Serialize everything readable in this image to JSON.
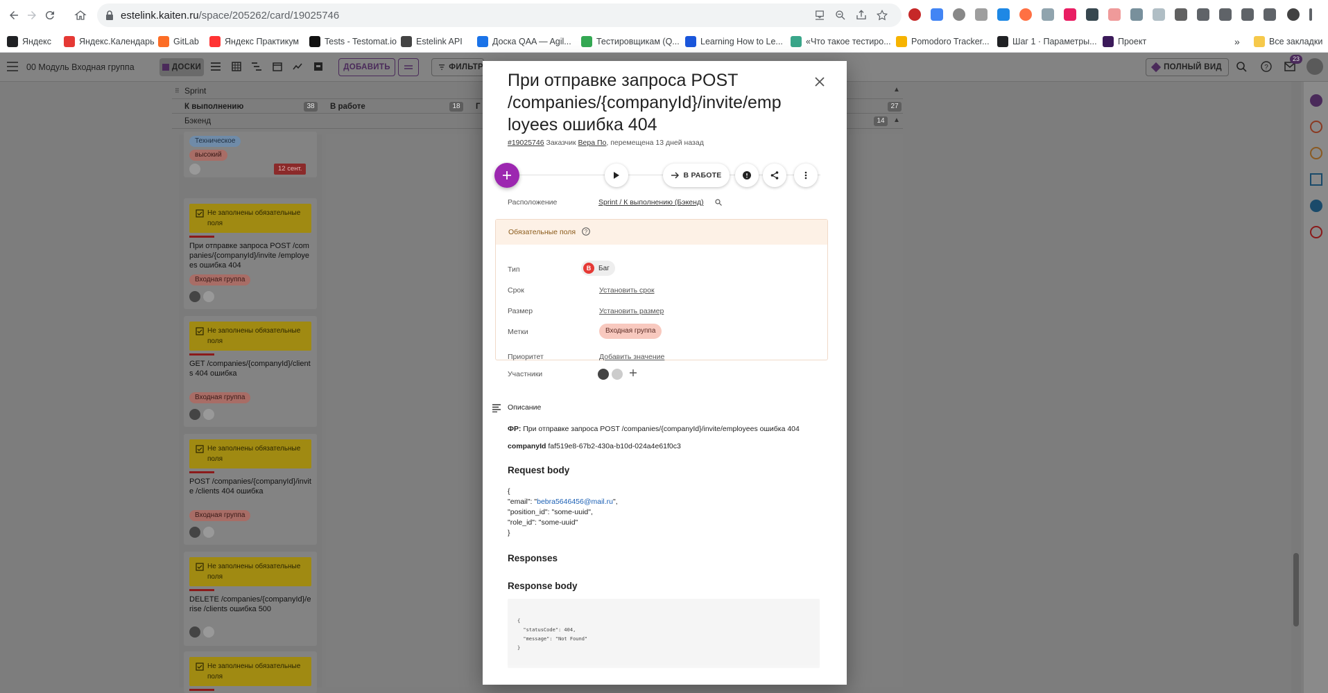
{
  "browser": {
    "url_host": "estelink.kaiten.ru",
    "url_path": "/space/205262/card/19025746",
    "bookmarks": [
      {
        "label": "Яндекс",
        "color": "#202124"
      },
      {
        "label": "Яндекс.Календарь",
        "color": "#e53935"
      },
      {
        "label": "GitLab",
        "color": "#fc6d26"
      },
      {
        "label": "Яндекс Практикум",
        "color": "#ff3333"
      },
      {
        "label": "Tests - Testomat.io",
        "color": "#111111"
      },
      {
        "label": "Estelink API",
        "color": "#444444"
      },
      {
        "label": "Доска QAA — Agil...",
        "color": "#1a73e8"
      },
      {
        "label": "Тестировщикам (Q...",
        "color": "#34a853"
      },
      {
        "label": "Learning How to Le...",
        "color": "#1a56db"
      },
      {
        "label": "«Что такое тестиро...",
        "color": "#3aa68a"
      },
      {
        "label": "Pomodoro Tracker...",
        "color": "#f6b300"
      },
      {
        "label": "Шаг 1 · Параметры...",
        "color": "#202124"
      },
      {
        "label": "Проект",
        "color": "#3b1a5a"
      }
    ],
    "bookmarks_overflow": "»",
    "all_bookmarks": "Все закладки"
  },
  "app": {
    "space_title": "00 Модуль Входная группа",
    "view_boards": "ДОСКИ",
    "add_label": "ДОБАВИТЬ",
    "filter_label": "ФИЛЬТР",
    "full_view_label": "ПОЛНЫЙ ВИД",
    "notif_count": "23",
    "lane_name": "Sprint",
    "columns": [
      {
        "title": "К выполнению",
        "count": "38"
      },
      {
        "title": "В работе",
        "count": "18"
      },
      {
        "title": "Г",
        "count": ""
      },
      {
        "title": "",
        "count": "27"
      }
    ],
    "sublane": "Бэкенд",
    "sublane_count": "14",
    "cards": [
      {
        "tags": [
          "Техническое",
          "высокий"
        ],
        "date": "12 сент."
      },
      {
        "warning": "Не заполнены обязательные поля",
        "title": "При отправке запроса POST /companies/{companyId}/invite /employees ошибка 404",
        "tag": "Входная группа"
      },
      {
        "warning": "Не заполнены обязательные поля",
        "title": "GET /companies/{companyId}/client s 404 ошибка",
        "tag": "Входная группа"
      },
      {
        "warning": "Не заполнены обязательные поля",
        "title": "POST /companies/{companyId}/invite /clients 404 ошибка",
        "tag": "Входная группа"
      },
      {
        "warning": "Не заполнены обязательные поля",
        "title": "DELETE /companies/{companyId}/erise /clients ошибка 500",
        "tag": ""
      },
      {
        "warning": "Не заполнены обязательные поля",
        "title": "",
        "tag": ""
      }
    ]
  },
  "modal": {
    "title": "При отправке запроса POST /companies/{companyId}/invite/emp loyees ошибка 404",
    "card_id": "#19025746",
    "meta_customer_label": "Заказчик",
    "meta_customer": "Вера По",
    "meta_moved": ", перемещена 13 дней назад",
    "in_work_label": "В РАБОТЕ",
    "location_label": "Расположение",
    "location_value": "Sprint / К выполнению (Бэкенд)",
    "required_title": "Обязательные поля",
    "fields": {
      "type_label": "Тип",
      "type_badge": "B",
      "type_value": "Баг",
      "due_label": "Срок",
      "due_value": "Установить срок",
      "size_label": "Размер",
      "size_value": "Установить размер",
      "tags_label": "Метки",
      "tags_value": "Входная группа",
      "priority_label": "Приоритет",
      "priority_value": "Добавить значение"
    },
    "members_label": "Участники",
    "description_label": "Описание",
    "fr_label": "ФР:",
    "fr_text": "При отправке запроса POST /companies/{companyId}/invite/employees ошибка 404",
    "company_label": "companyId",
    "company_value": "faf519e8-67b2-430a-b10d-024a4e61f0c3",
    "request_body_title": "Request body",
    "request_body_line1": "{",
    "request_body_email_key": "\"email\": \"",
    "request_body_email": "bebra5646456@mail.ru",
    "request_body_email_end": "\",",
    "request_body_line3": "\"position_id\": \"some-uuid\",",
    "request_body_line4": "\"role_id\": \"some-uuid\"",
    "request_body_line5": "}",
    "responses_title": "Responses",
    "response_body_title": "Response body",
    "response_code": "{\n  \"statusCode\": 404,\n  \"message\": \"Not Found\"\n}"
  },
  "colors": {
    "accent": "#9c27b0",
    "warning_yellow": "#a08a12",
    "tag_pink": "#f8c9bf",
    "bug_red": "#e53935"
  }
}
